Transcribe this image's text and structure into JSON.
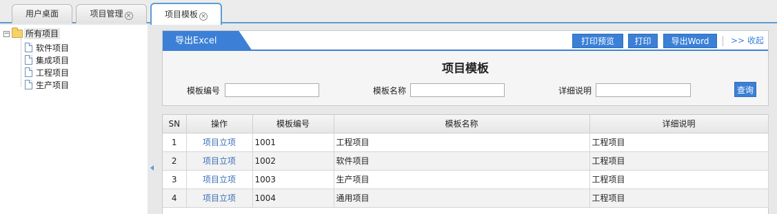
{
  "tabs": [
    {
      "label": "用户桌面",
      "closable": false
    },
    {
      "label": "项目管理",
      "closable": true
    },
    {
      "label": "项目模板",
      "closable": true,
      "active": true
    }
  ],
  "tab_close_glyph": "×",
  "tree": {
    "toggle": "−",
    "root": "所有项目",
    "children": [
      "软件项目",
      "集成项目",
      "工程项目",
      "生产项目"
    ]
  },
  "toolbar": {
    "export_excel": "导出Excel",
    "print_preview": "打印预览",
    "print": "打印",
    "export_word": "导出Word",
    "collapse": ">> 收起"
  },
  "page_title": "项目模板",
  "filters": {
    "code_label": "模板编号",
    "code_value": "",
    "name_label": "模板名称",
    "name_value": "",
    "desc_label": "详细说明",
    "desc_value": "",
    "query": "查询"
  },
  "table": {
    "headers": [
      "SN",
      "操作",
      "模板编号",
      "模板名称",
      "详细说明"
    ],
    "rows": [
      {
        "sn": "1",
        "action": "项目立项",
        "code": "1001",
        "name": "工程项目",
        "desc": "工程项目"
      },
      {
        "sn": "2",
        "action": "项目立项",
        "code": "1002",
        "name": "软件项目",
        "desc": "工程项目"
      },
      {
        "sn": "3",
        "action": "项目立项",
        "code": "1003",
        "name": "生产项目",
        "desc": "工程项目"
      },
      {
        "sn": "4",
        "action": "项目立项",
        "code": "1004",
        "name": "通用项目",
        "desc": "工程项目"
      }
    ]
  },
  "colors": {
    "accent": "#3b80d6",
    "link": "#3b6fb8"
  }
}
